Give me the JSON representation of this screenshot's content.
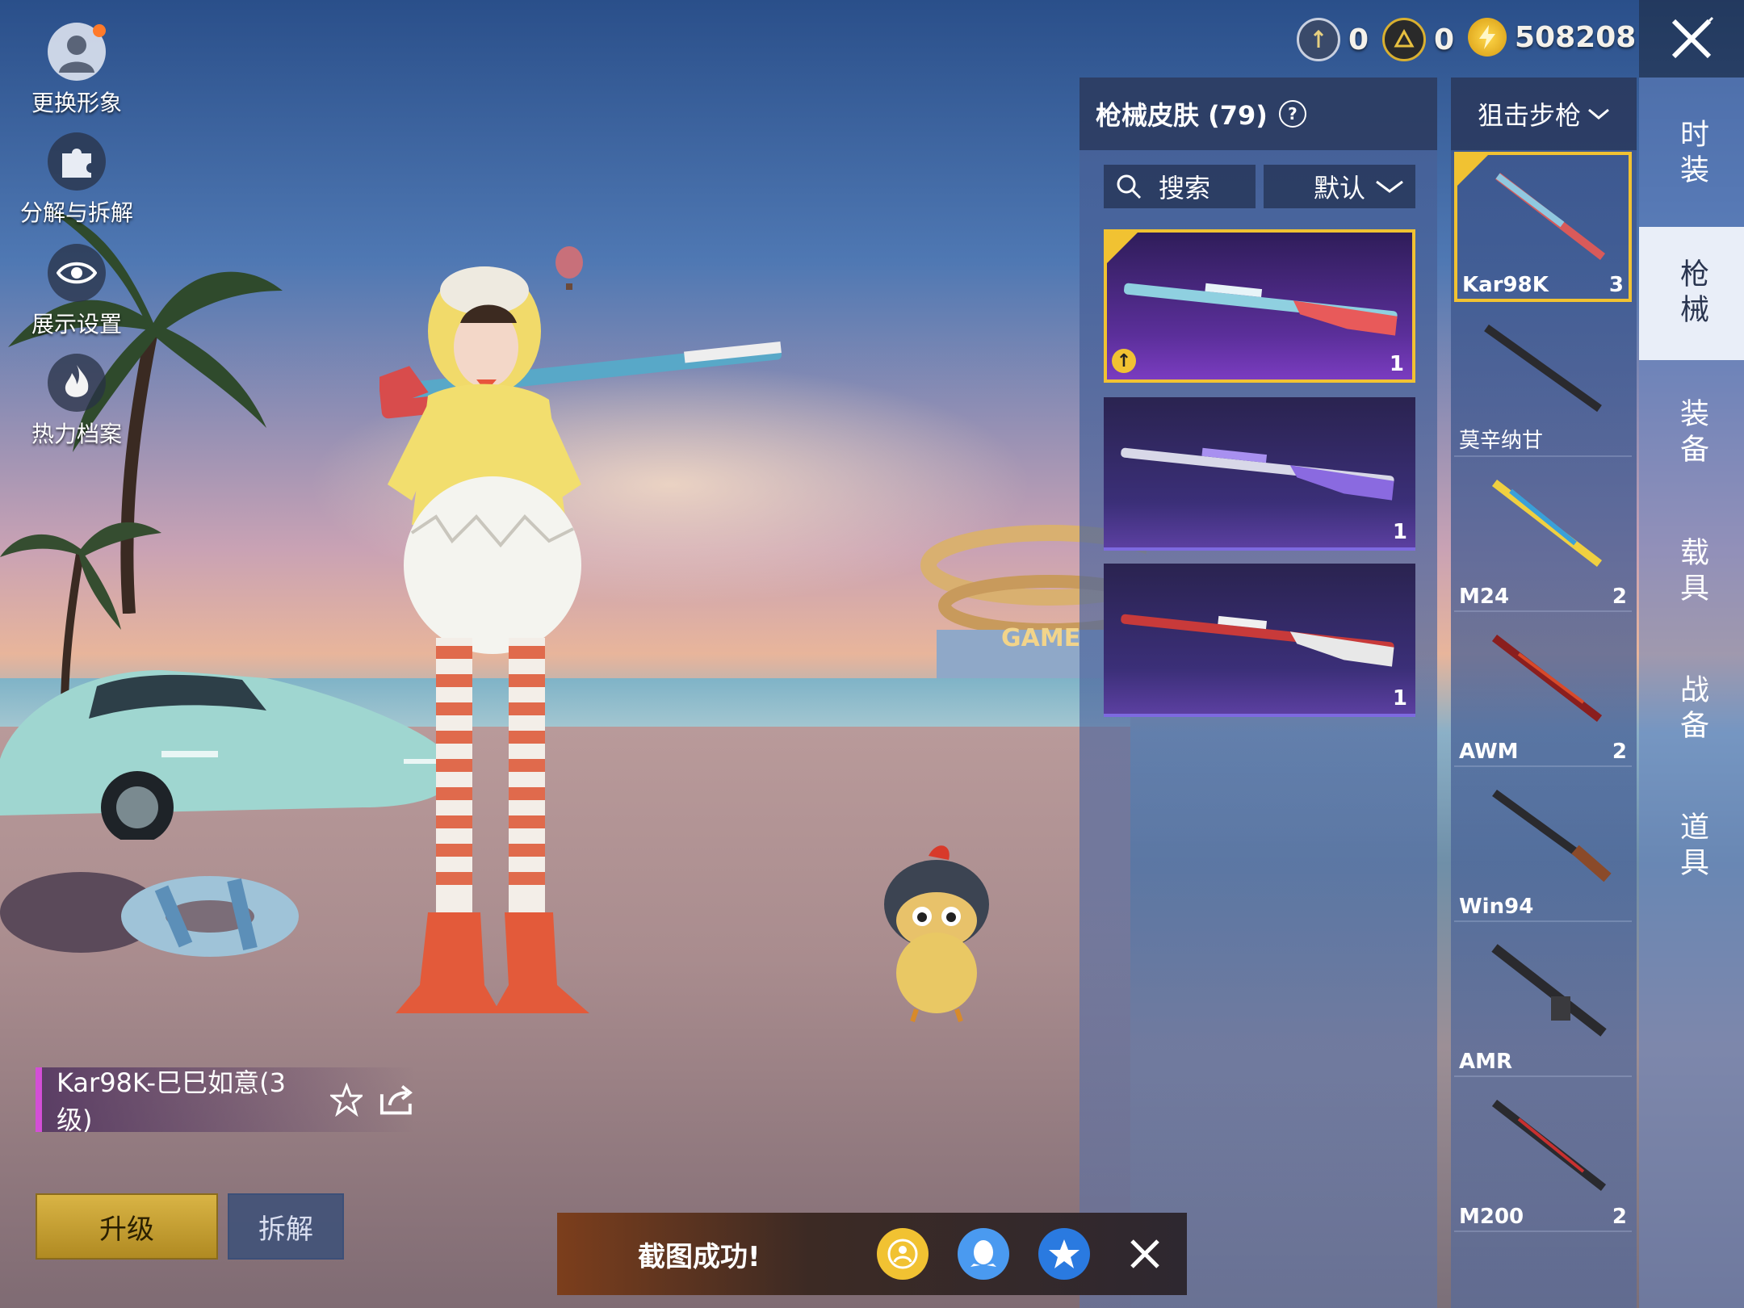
{
  "currency": {
    "item1_value": "0",
    "item2_value": "0",
    "coins_value": "508208"
  },
  "left_menu": {
    "change_avatar": "更换形象",
    "decompose": "分解与拆解",
    "display_settings": "展示设置",
    "heat_archive": "热力档案"
  },
  "skins_panel": {
    "title": "枪械皮肤 (79)",
    "search_label": "搜索",
    "sort_label": "默认",
    "cards": [
      {
        "count": "1"
      },
      {
        "count": "1"
      },
      {
        "count": "1"
      }
    ]
  },
  "weapon_list": {
    "category": "狙击步枪",
    "items": [
      {
        "name": "Kar98K",
        "count": "3"
      },
      {
        "name": "莫辛纳甘",
        "count": ""
      },
      {
        "name": "M24",
        "count": "2"
      },
      {
        "name": "AWM",
        "count": "2"
      },
      {
        "name": "Win94",
        "count": ""
      },
      {
        "name": "AMR",
        "count": ""
      },
      {
        "name": "M200",
        "count": "2"
      }
    ]
  },
  "tabs": [
    "时装",
    "枪械",
    "装备",
    "载具",
    "战备",
    "道具"
  ],
  "selected_skin": {
    "name": "Kar98K-巳巳如意(3级)"
  },
  "buttons": {
    "upgrade": "升级",
    "disassemble": "拆解"
  },
  "toast": {
    "message": "截图成功!"
  },
  "colors": {
    "accent_gold": "#f1c232",
    "skin_card_purple": "#5b2f9a",
    "active_tab_bg": "#e9eef8"
  }
}
